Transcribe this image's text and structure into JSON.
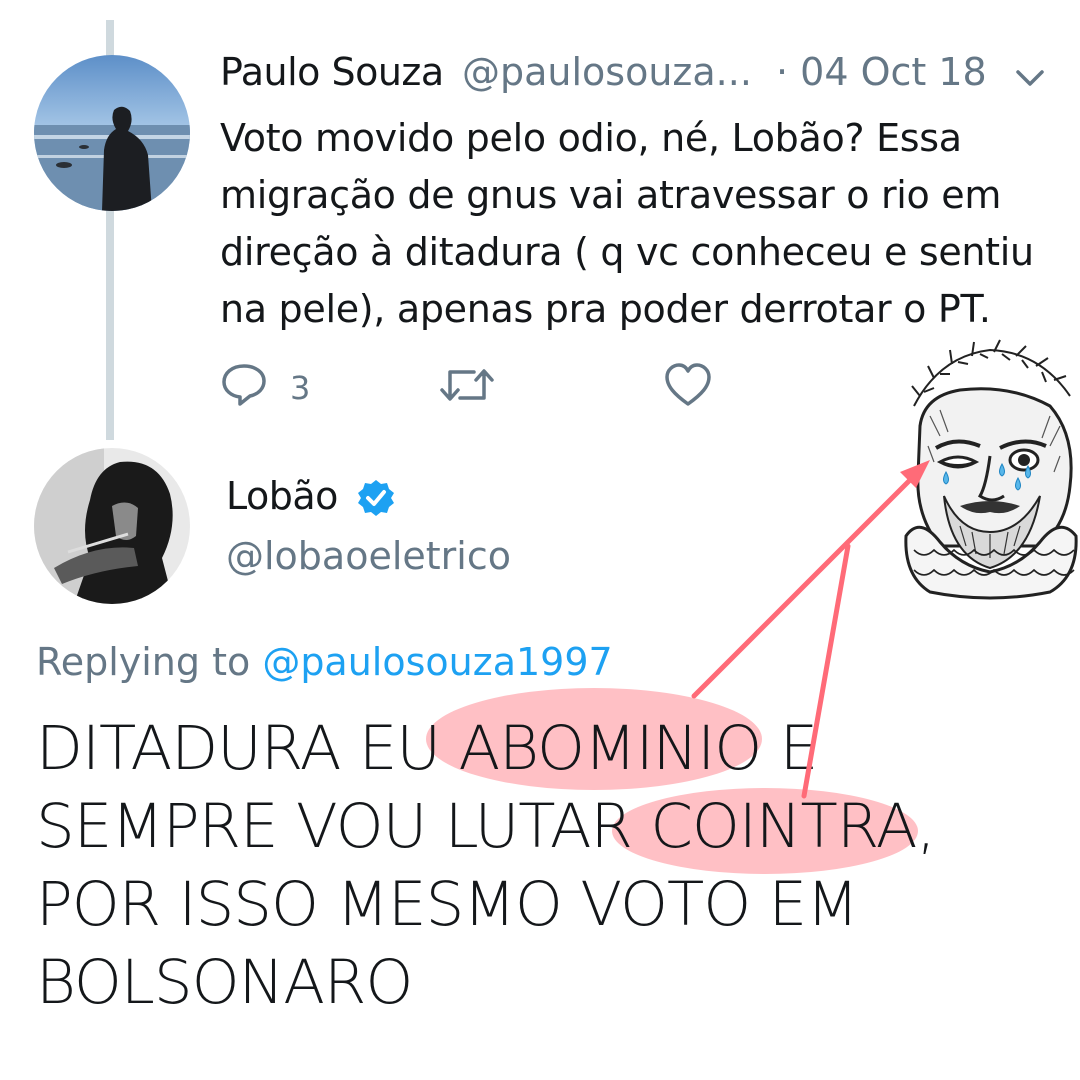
{
  "reply_tweet": {
    "author_name": "Paulo Souza",
    "author_handle": "@paulosouza...",
    "date": "· 04 Oct 18",
    "text_lines": [
      "Voto movido pelo odio, né, Lobão? Essa",
      "migração de gnus vai atravessar o rio em",
      "direção à ditadura ( q vc conheceu e sentiu",
      "na pele), apenas pra poder derrotar o PT."
    ],
    "reply_count": "3"
  },
  "main_tweet": {
    "author_name": "Lobão",
    "author_handle": "@lobaoeletrico",
    "replying_prefix": "Replying to ",
    "replying_handle": "@paulosouza1997",
    "text_lines": [
      "DITADURA EU ABOMINIO E",
      "SEMPRE VOU LUTAR COINTRA,",
      "POR ISSO MESMO VOTO EM",
      "BOLSONARO"
    ]
  },
  "colors": {
    "accent": "#1da1f2",
    "muted": "#657786",
    "highlight": "#ff8a95",
    "arrow": "#ff6b78",
    "thread_line": "#cfd9de"
  },
  "icons": [
    "reply-icon",
    "retweet-icon",
    "like-icon",
    "verified-badge-icon",
    "chevron-down-icon",
    "crying-poet-sticker"
  ]
}
